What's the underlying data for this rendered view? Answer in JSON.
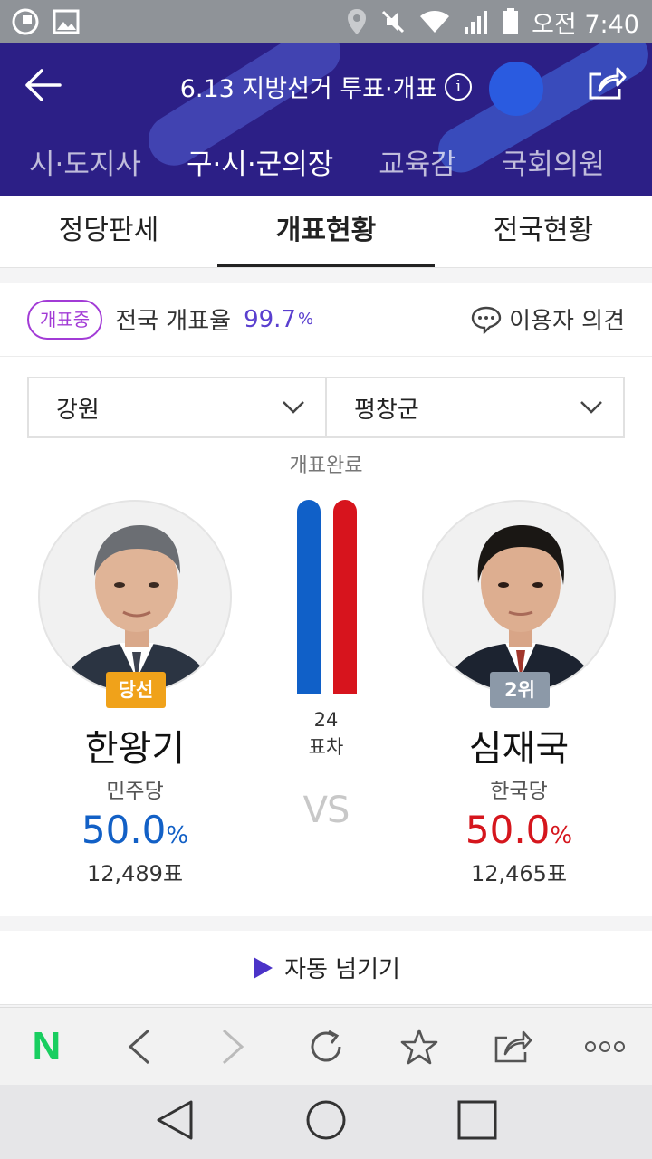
{
  "status_bar": {
    "time": "오전 7:40"
  },
  "header": {
    "title": "6.13 지방선거 투표·개표",
    "tabs": [
      "시·도지사",
      "구·시·군의장",
      "교육감",
      "국회의원"
    ]
  },
  "sub_tabs": [
    "정당판세",
    "개표현황",
    "전국현황"
  ],
  "summary": {
    "badge": "개표중",
    "rate_label": "전국 개표율",
    "rate_value": "99.7",
    "rate_unit": "%",
    "opinion_label": "이용자 의견"
  },
  "region": {
    "province": "강원",
    "district": "평창군"
  },
  "count_status": "개표완료",
  "candidates": [
    {
      "badge": "당선",
      "name": "한왕기",
      "party": "민주당",
      "percent": "50.0",
      "unit": "%",
      "votes": "12,489표"
    },
    {
      "badge": "2위",
      "name": "심재국",
      "party": "한국당",
      "percent": "50.0",
      "unit": "%",
      "votes": "12,465표"
    }
  ],
  "margin": {
    "count": "24",
    "label": "표차"
  },
  "vs_label": "VS",
  "vote_share": {
    "left": 0.5,
    "right": 0.5
  },
  "auto_advance": "자동 넘기기",
  "browser": {
    "logo": "N"
  },
  "colors": {
    "header": "#2c1f86",
    "left_party": "#1260c6",
    "right_party": "#d5161d",
    "accent": "#5a3fcf"
  }
}
